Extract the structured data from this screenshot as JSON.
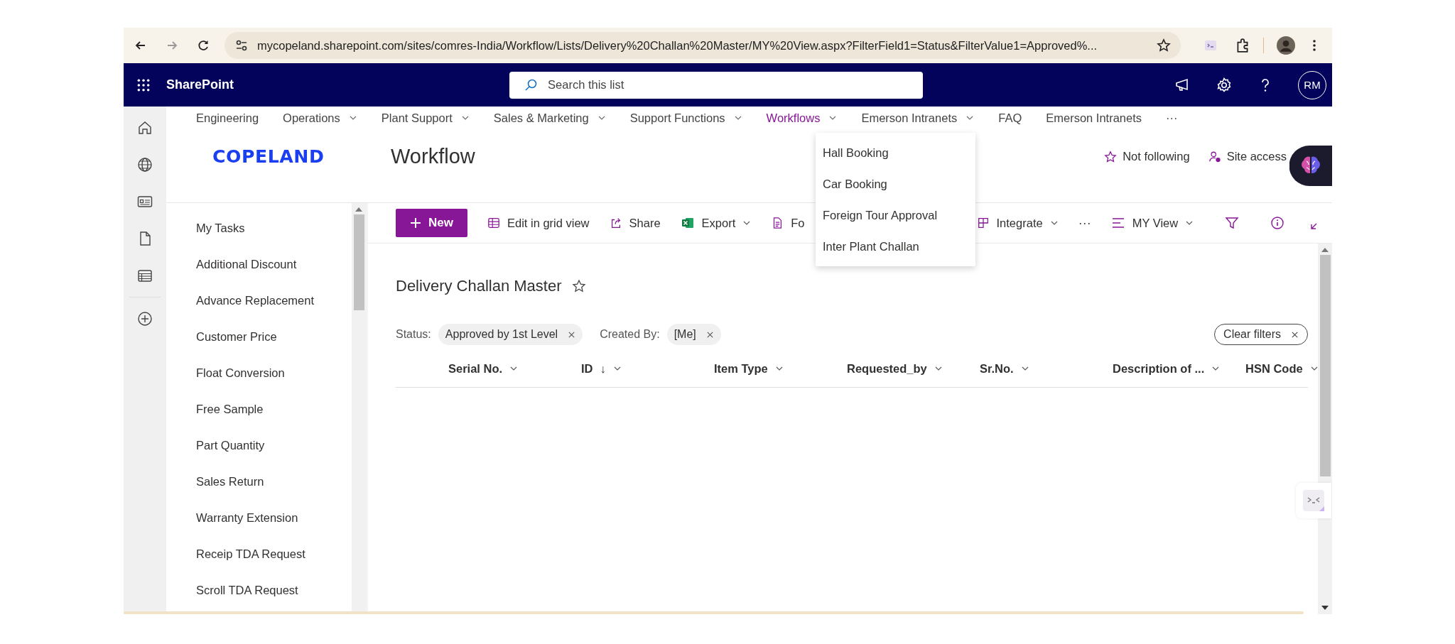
{
  "browser": {
    "back": {
      "disabled": false
    },
    "forward": {
      "disabled": true
    },
    "url": "mycopeland.sharepoint.com/sites/comres-India/Workflow/Lists/Delivery%20Challan%20Master/MY%20View.aspx?FilterField1=Status&FilterValue1=Approved%..."
  },
  "suite_bar": {
    "app_name": "SharePoint",
    "search": {
      "placeholder": "Search this list"
    },
    "account": {
      "initials": "RM"
    }
  },
  "site_nav": [
    {
      "label": "Engineering",
      "has_menu": false,
      "selected": false
    },
    {
      "label": "Operations",
      "has_menu": true,
      "selected": false
    },
    {
      "label": "Plant Support",
      "has_menu": true,
      "selected": false
    },
    {
      "label": "Sales & Marketing",
      "has_menu": true,
      "selected": false
    },
    {
      "label": "Support Functions",
      "has_menu": true,
      "selected": false
    },
    {
      "label": "Workflows",
      "has_menu": true,
      "selected": true
    },
    {
      "label": "Emerson Intranets",
      "has_menu": true,
      "selected": false
    },
    {
      "label": "FAQ",
      "has_menu": false,
      "selected": false
    },
    {
      "label": "Emerson Intranets",
      "has_menu": false,
      "selected": false
    },
    {
      "label": "···",
      "has_menu": false,
      "selected": false
    }
  ],
  "nav_dropdown": [
    "Hall Booking",
    "Car Booking",
    "Foreign Tour Approval",
    "Inter Plant Challan"
  ],
  "site_header": {
    "logo": "COPELAND",
    "title": "Workflow",
    "follow": "Not following",
    "site_access": "Site access"
  },
  "left_nav": [
    "My Tasks",
    "Additional Discount",
    "Advance Replacement",
    "Customer Price",
    "Float Conversion",
    "Free Sample",
    "Part Quantity",
    "Sales Return",
    "Warranty Extension",
    "Receip TDA Request",
    "Scroll TDA Request"
  ],
  "command_bar": [
    {
      "label": "New",
      "kind": "primary"
    },
    {
      "label": "Edit in grid view",
      "kind": "command",
      "has_menu": false
    },
    {
      "label": "Share",
      "kind": "command",
      "has_menu": false
    },
    {
      "label": "Export",
      "kind": "command",
      "has_menu": true
    },
    {
      "label": "Fo",
      "kind": "covered",
      "has_menu": false
    },
    {
      "label": "Integrate",
      "kind": "command",
      "has_menu": true
    },
    {
      "label": "···",
      "kind": "overflow"
    },
    {
      "label": "MY View",
      "kind": "command",
      "has_menu": true
    }
  ],
  "list": {
    "title": "Delivery Challan Master",
    "filters": [
      {
        "field": "Status:",
        "value": "Approved by 1st Level"
      },
      {
        "field": "Created By:",
        "value": "[Me]"
      }
    ],
    "clear_filters": "Clear filters",
    "columns": [
      {
        "label": "Serial No."
      },
      {
        "label": "ID",
        "sort_indicator": "↓"
      },
      {
        "label": "Item Type"
      },
      {
        "label": "Requested_by"
      },
      {
        "label": "Sr.No."
      },
      {
        "label": "Description of ..."
      },
      {
        "label": "HSN Code"
      }
    ]
  }
}
